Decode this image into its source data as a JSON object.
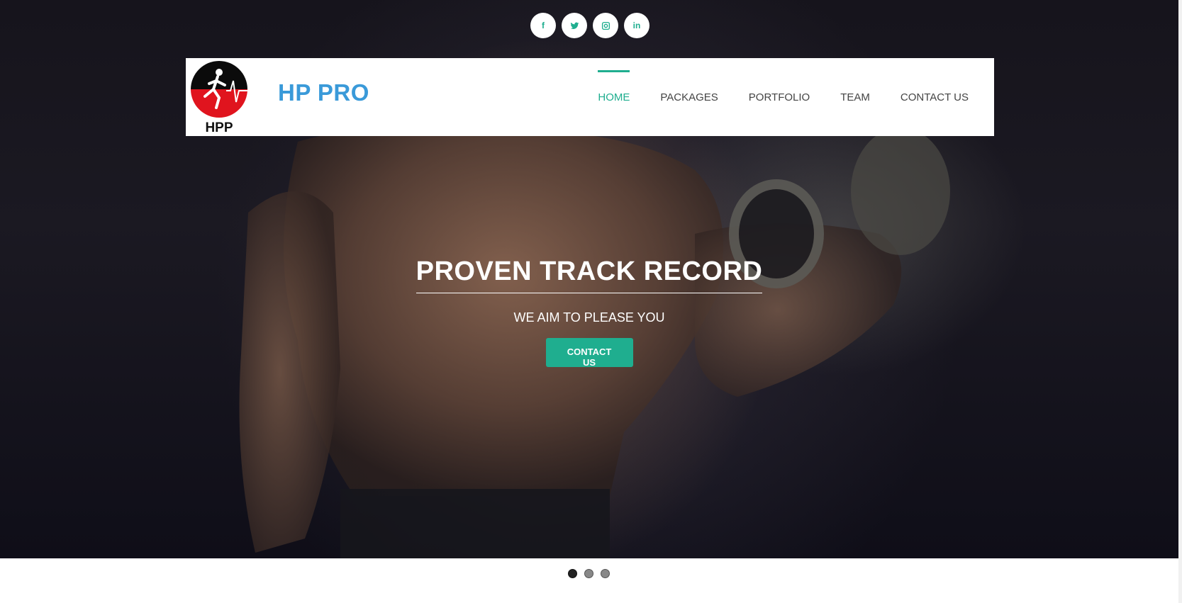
{
  "social": [
    {
      "icon": "facebook-icon",
      "label": "f"
    },
    {
      "icon": "twitter-icon",
      "label": ""
    },
    {
      "icon": "instagram-icon",
      "label": ""
    },
    {
      "icon": "linkedin-icon",
      "label": "in"
    }
  ],
  "navbar": {
    "logo_text": "HPP",
    "brand": "HP PRO",
    "items": [
      {
        "label": "HOME",
        "active": true
      },
      {
        "label": "PACKAGES"
      },
      {
        "label": "PORTFOLIO"
      },
      {
        "label": "TEAM"
      },
      {
        "label": "CONTACT US"
      }
    ]
  },
  "hero": {
    "title": "PROVEN TRACK RECORD",
    "subtitle": "WE AIM TO PLEASE YOU",
    "cta_label": "CONTACT US"
  },
  "carousel": {
    "slides": 3,
    "active": 1
  },
  "colors": {
    "accent": "#1fae8f",
    "brand": "#3a9ad9",
    "logo_red": "#e0141e"
  }
}
